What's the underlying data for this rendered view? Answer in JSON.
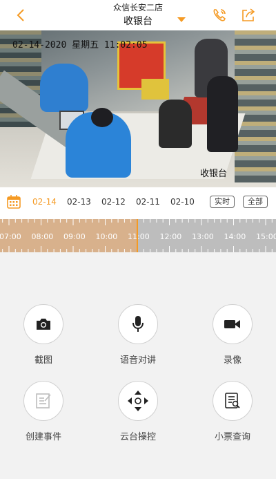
{
  "header": {
    "store_name": "众信长安二店",
    "camera_name": "收银台"
  },
  "icons": {
    "back": "chevron-left-icon",
    "dropdown": "caret-down-icon",
    "call": "phone-call-icon",
    "share": "share-out-icon"
  },
  "video": {
    "timestamp": "02-14-2020 星期五 11:02:05",
    "camera_label": "收银台"
  },
  "date_bar": {
    "dates": [
      "02-14",
      "02-13",
      "02-12",
      "02-11",
      "02-10"
    ],
    "selected_date": "02-14",
    "live_label": "实时",
    "all_label": "全部"
  },
  "timeline": {
    "hours": [
      "07:00",
      "08:00",
      "09:00",
      "10:00",
      "11:00",
      "12:00",
      "13:00",
      "14:00",
      "15:00"
    ],
    "current_time": "11:00"
  },
  "actions": {
    "screenshot": "截图",
    "voice": "语音对讲",
    "record": "录像",
    "create_event": "创建事件",
    "ptz": "云台操控",
    "receipt": "小票查询"
  },
  "colors": {
    "accent": "#f59a23",
    "recorded": "#d8b18c",
    "unrecorded": "#bdbdbd"
  }
}
